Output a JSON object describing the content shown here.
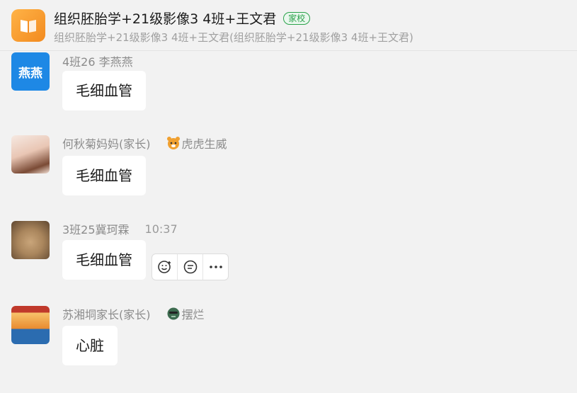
{
  "header": {
    "title": "组织胚胎学+21级影像3 4班+王文君",
    "badge": "家校",
    "subtitle": "组织胚胎学+21级影像3 4班+王文君(组织胚胎学+21级影像3 4班+王文君)",
    "icon": "book-icon"
  },
  "messages": [
    {
      "sender": "4班26 李燕燕",
      "avatar_text": "燕燕",
      "text": "毛细血管"
    },
    {
      "sender": "何秋菊妈妈(家长)",
      "tag": "虎虎生威",
      "text": "毛细血管"
    },
    {
      "sender": "3班25冀珂霖",
      "time": "10:37",
      "text": "毛细血管"
    },
    {
      "sender": "苏湘垌家长(家长)",
      "tag": "摆烂",
      "text": "心脏"
    }
  ],
  "actions": [
    "emoji-reaction-icon",
    "quote-reply-icon",
    "more-icon"
  ],
  "colors": {
    "accent": "#2aa24a",
    "avatar_blue": "#1e88e5",
    "group_orange": "#f5a03a"
  }
}
